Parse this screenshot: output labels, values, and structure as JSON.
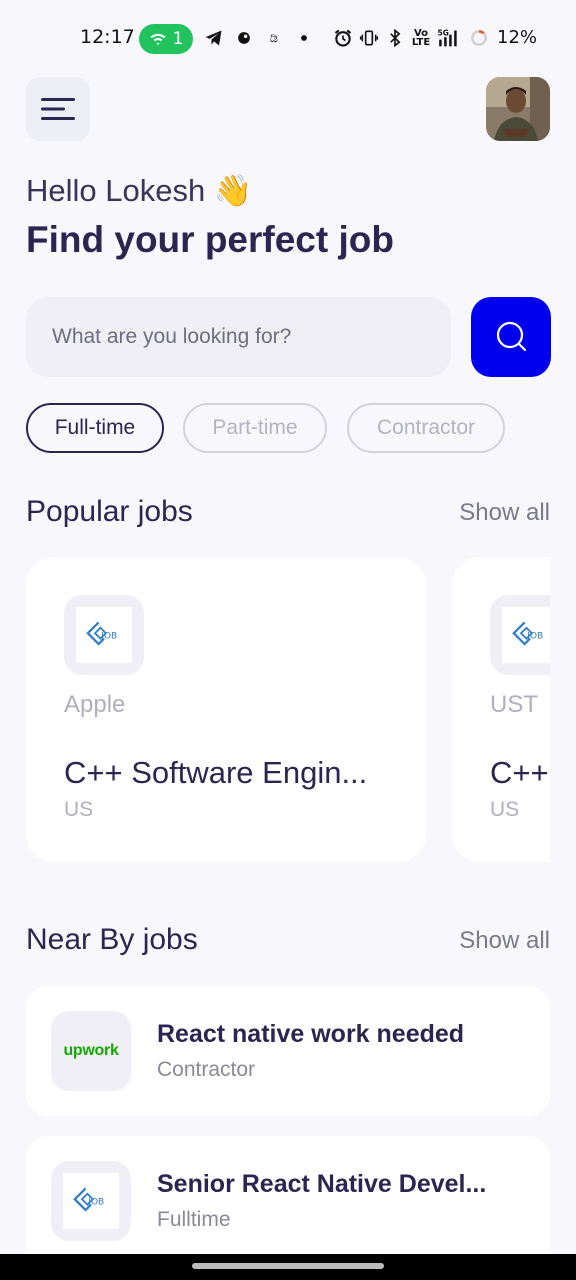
{
  "status_bar": {
    "time": "12:17",
    "hotspot_count": "1",
    "battery": "12%",
    "icons_left": [
      "telegram-icon",
      "app-icon",
      "app-icon-2",
      "dot-icon"
    ],
    "icons_right": [
      "alarm-icon",
      "vibrate-icon",
      "bluetooth-icon",
      "volte-icon",
      "signal-5g-icon",
      "battery-icon"
    ]
  },
  "header": {
    "greeting": "Hello Lokesh 👋",
    "headline": "Find your perfect job"
  },
  "search": {
    "placeholder": "What are you looking for?"
  },
  "filters": [
    {
      "label": "Full-time",
      "active": true
    },
    {
      "label": "Part-time",
      "active": false
    },
    {
      "label": "Contractor",
      "active": false
    }
  ],
  "popular": {
    "title": "Popular jobs",
    "show_all": "Show all",
    "jobs": [
      {
        "company": "Apple",
        "title": "C++ Software Engin...",
        "location": "US",
        "logo": "job-logo-icon"
      },
      {
        "company": "UST",
        "title": "C++",
        "location": "US",
        "logo": "job-logo-icon"
      }
    ]
  },
  "nearby": {
    "title": "Near By jobs",
    "show_all": "Show all",
    "jobs": [
      {
        "title": "React native work needed",
        "type": "Contractor",
        "logo_text": "upwork"
      },
      {
        "title": "Senior React Native Devel...",
        "type": "Fulltime",
        "logo": "job-logo-icon"
      }
    ]
  },
  "colors": {
    "accent": "#0000ee",
    "text_primary": "#2c2550",
    "background": "#f8f8fc",
    "upwork_green": "#14a800"
  }
}
